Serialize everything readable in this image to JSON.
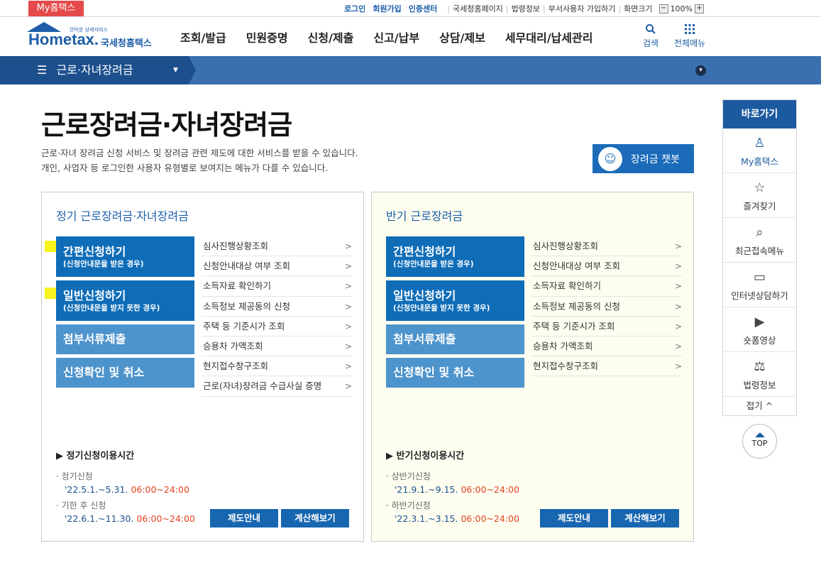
{
  "topbar": {
    "my_label": "My홈택스",
    "login": "로그인",
    "signup": "회원가입",
    "cert": "인증센터",
    "links": [
      "국세청홈페이지",
      "법령정보",
      "부서사용자 가입하기",
      "화면크기"
    ],
    "zoom_minus": "−",
    "zoom_value": "100%",
    "zoom_plus": "+"
  },
  "header": {
    "logo_sub": "안미운 상세서비스",
    "logo_main": "Hometax.",
    "logo_kr": "국세청홈택스",
    "menu": [
      "조회/발급",
      "민원증명",
      "신청/제출",
      "신고/납부",
      "상담/제보",
      "세무대리/납세관리"
    ],
    "search_label": "검색",
    "allmenu_label": "전체메뉴"
  },
  "nav": {
    "menu_icon": "☰",
    "title": "근로·자녀장려금",
    "dropdown_icon": "▼",
    "circle_icon": "▾"
  },
  "page": {
    "title": "근로장려금·자녀장려금",
    "desc1": "근로·자녀 장려금 신청 서비스 및 장려금 관련 제도에 대한 서비스를 받을 수 있습니다.",
    "desc2": "개인, 사업자 등 로그인한 사용자 유형별로 보여지는 메뉴가 다를 수 있습니다.",
    "chatbot_label": "장려금 챗봇",
    "chatbot_icon": "☺"
  },
  "left_panel": {
    "title": "정기 근로장려금·자녀장려금",
    "btn1_l1": "간편신청하기",
    "btn1_l2": "(신청안내문을 받은 경우)",
    "btn2_l1": "일반신청하기",
    "btn2_l2": "(신청안내문을 받지 못한 경우)",
    "btn3": "첨부서류제출",
    "btn4": "신청확인 및 취소",
    "links": [
      "심사진행상황조회",
      "신청안내대상 여부 조회",
      "소득자료 확인하기",
      "소득정보 제공동의 신청",
      "주택 등 기준시가 조회",
      "승용차 가액조회",
      "현지접수창구조회",
      "근로(자녀)장려금 수급사실 증명"
    ],
    "usage_title": "▶ 정기신청이용시간",
    "usage1_label": "· 정기신청",
    "usage1_date": "'22.5.1.~5.31.",
    "usage1_time": "06:00~24:00",
    "usage2_label": "· 기한 후 신청",
    "usage2_date": "'22.6.1.~11.30.",
    "usage2_time": "06:00~24:00",
    "guide_btn": "제도안내",
    "calc_btn": "계산해보기"
  },
  "right_panel": {
    "title": "반기 근로장려금",
    "btn1_l1": "간편신청하기",
    "btn1_l2": "(신청안내문을 받은 경우)",
    "btn2_l1": "일반신청하기",
    "btn2_l2": "(신청안내문을 받지 못한 경우)",
    "btn3": "첨부서류제출",
    "btn4": "신청확인 및 취소",
    "links": [
      "심사진행상황조회",
      "신청안내대상 여부 조회",
      "소득자료 확인하기",
      "소득정보 제공동의 신청",
      "주택 등 기준시가 조회",
      "승용차 가액조회",
      "현지접수창구조회"
    ],
    "usage_title": "▶ 반기신청이용시간",
    "usage1_label": "· 상반기신청",
    "usage1_date": "'21.9.1.~9.15.",
    "usage1_time": "06:00~24:00",
    "usage2_label": "· 하반기신청",
    "usage2_date": "'22.3.1.~3.15.",
    "usage2_time": "06:00~24:00",
    "guide_btn": "제도안내",
    "calc_btn": "계산해보기"
  },
  "quick": {
    "title": "바로가기",
    "items": [
      {
        "label": "My홈택스",
        "icon": "♙"
      },
      {
        "label": "즐겨찾기",
        "icon": "☆"
      },
      {
        "label": "최근접속메뉴",
        "icon": "⌕"
      },
      {
        "label": "인터넷상담하기",
        "icon": "▭"
      },
      {
        "label": "숏폼영상",
        "icon": "▶"
      },
      {
        "label": "법령정보",
        "icon": "⚖"
      }
    ],
    "fold": "접기 ^",
    "top": "TOP"
  },
  "colors": {
    "accent": "#1c5aa0",
    "highlight": "#f7f31c",
    "time_red": "#e0421e"
  }
}
